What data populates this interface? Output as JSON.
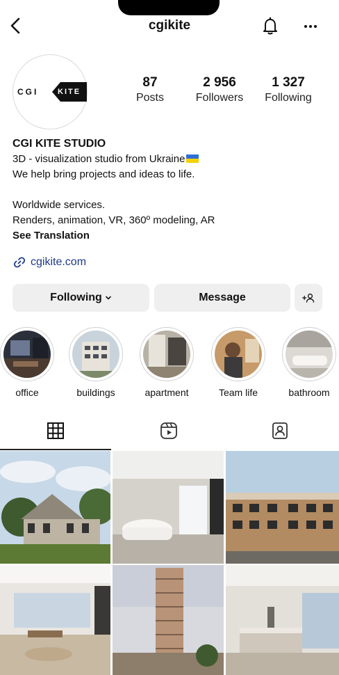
{
  "header": {
    "username": "cgikite",
    "back_icon": "chevron-left-icon",
    "bell_icon": "bell-icon",
    "more_icon": "more-horizontal-icon"
  },
  "avatar": {
    "logo_left": "CGI",
    "logo_right": "KITE"
  },
  "stats": {
    "posts_count": "87",
    "posts_label": "Posts",
    "followers_count": "2 956",
    "followers_label": "Followers",
    "following_count": "1 327",
    "following_label": "Following"
  },
  "bio": {
    "name": "CGI KITE STUDIO",
    "line1": "3D - visualization studio from Ukraine",
    "line2": "We help bring projects and ideas to life.",
    "line3": "Worldwide services.",
    "line4": "Renders, animation, VR, 360º modeling, AR",
    "see_translation": "See Translation",
    "flag_colors": [
      "#2f6fd6",
      "#f5d100"
    ]
  },
  "link": {
    "text": "cgikite.com",
    "icon": "link-icon"
  },
  "buttons": {
    "following": "Following",
    "message": "Message",
    "add_user_icon": "add-user-icon"
  },
  "highlights": [
    {
      "label": "office"
    },
    {
      "label": "buildings"
    },
    {
      "label": "apartment"
    },
    {
      "label": "Team life"
    },
    {
      "label": "bathroom"
    }
  ],
  "tabs": {
    "grid_icon": "grid-icon",
    "reels_icon": "reels-icon",
    "tagged_icon": "tagged-icon",
    "active": "grid"
  },
  "colors": {
    "link": "#1d3a8a",
    "button_bg": "#efefef"
  }
}
